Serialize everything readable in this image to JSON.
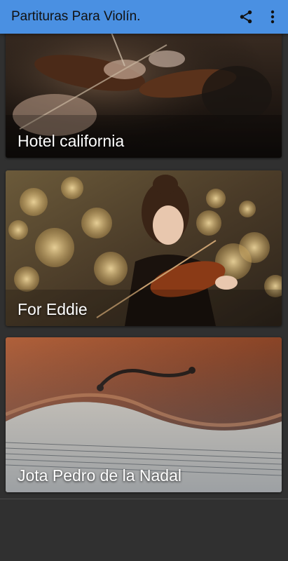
{
  "app": {
    "title": "Partituras Para Violín.",
    "bar_color": "#4a90e2"
  },
  "toolbar": {
    "share_icon": "share-icon",
    "more_icon": "more-vert-icon"
  },
  "cards": [
    {
      "title": "Hotel california",
      "image": "orchestra-violinists"
    },
    {
      "title": "For Eddie",
      "image": "woman-playing-violin-bokeh"
    },
    {
      "title": "Jota Pedro de la Nadal",
      "image": "violin-on-sheet-music"
    }
  ]
}
